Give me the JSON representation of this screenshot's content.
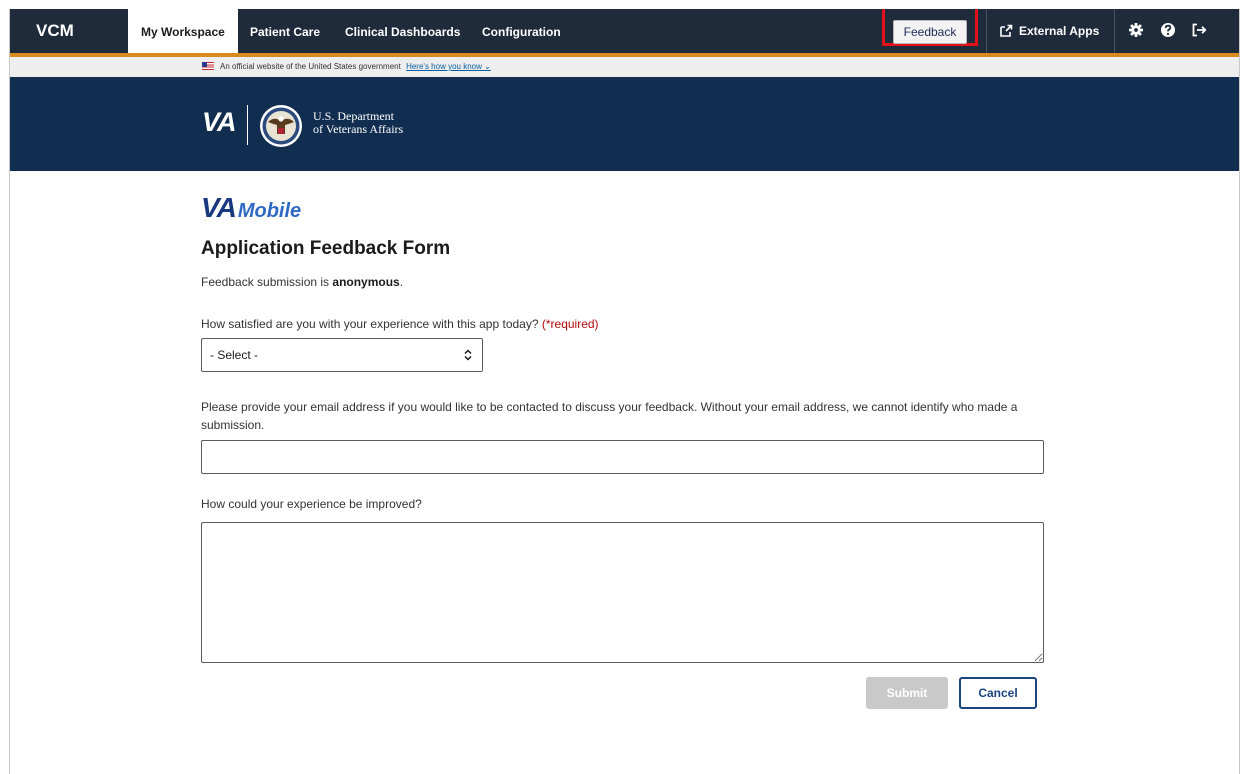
{
  "topnav": {
    "brand": "VCM",
    "tabs": [
      {
        "label": "My Workspace",
        "active": true
      },
      {
        "label": "Patient Care",
        "active": false
      },
      {
        "label": "Clinical Dashboards",
        "active": false
      },
      {
        "label": "Configuration",
        "active": false
      }
    ],
    "feedback_label": "Feedback",
    "external_apps_label": "External Apps",
    "icons": [
      "external-link-icon",
      "gear-icon",
      "help-icon",
      "logout-icon"
    ],
    "colors": {
      "navbar": "#1f2a3a",
      "accent": "#d98a1f",
      "highlight": "#e3101b"
    }
  },
  "gov_banner": {
    "text": "An official website of the United States government",
    "link": "Here's how you know"
  },
  "va_header": {
    "logo": "VA",
    "dept_line1": "U.S. Department",
    "dept_line2": "of Veterans Affairs",
    "color": "#112e51"
  },
  "form": {
    "brand_va": "VA",
    "brand_mobile": "Mobile",
    "title": "Application Feedback Form",
    "anon_prefix": "Feedback submission is ",
    "anon_bold": "anonymous",
    "anon_suffix": ".",
    "q1_label": "How satisfied are you with your experience with this app today? ",
    "q1_required": "(*required)",
    "select_value": "- Select -",
    "q2_label": "Please provide your email address if you would like to be contacted to discuss your feedback. Without your email address, we cannot identify who made a submission.",
    "email_value": "",
    "q3_label": "How could your experience be improved?",
    "improve_value": "",
    "submit_label": "Submit",
    "cancel_label": "Cancel"
  }
}
